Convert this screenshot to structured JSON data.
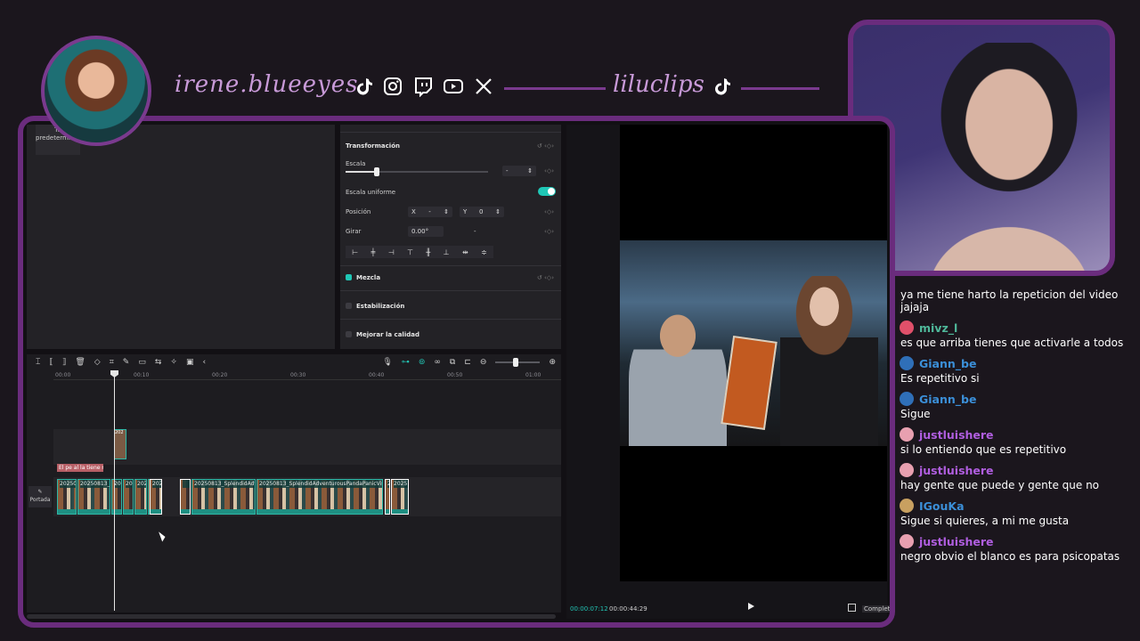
{
  "overlay": {
    "streamer_name": "irene.blueeyes",
    "clips_name": "liluclips",
    "socials": [
      "tiktok-icon",
      "instagram-icon",
      "twitch-icon",
      "youtube-icon",
      "x-icon"
    ],
    "accent_color": "#6a2c7d"
  },
  "editor": {
    "left_panel": {
      "default_tile": "Tu predeterminado"
    },
    "properties": {
      "transform_title": "Transformación",
      "scale_label": "Escala",
      "scale_value": "-",
      "uniform_scale_label": "Escala uniforme",
      "position_label": "Posición",
      "pos_x_label": "X",
      "pos_x_value": "-",
      "pos_y_label": "Y",
      "pos_y_value": "0",
      "rotate_label": "Girar",
      "rotate_value": "0.00°",
      "rotate_extra": "-",
      "blend_label": "Mezcla",
      "stabilize_label": "Estabilización",
      "enhance_label": "Mejorar la calidad"
    },
    "timeline": {
      "ruler": [
        "00:00",
        "00:10",
        "00:20",
        "00:30",
        "00:40",
        "00:50",
        "01:00"
      ],
      "cover_label": "Portada",
      "text_clip": "El pe al la tiene r",
      "overlay_clip": "202",
      "clips": [
        "20250",
        "20250813_S",
        "202",
        "20",
        "202",
        "202",
        "2025",
        "",
        "20250813_SplendidAdven",
        "20250813_SplendidAdventurousPandaPanicVis-4Z-3",
        "2",
        "2025"
      ]
    },
    "player": {
      "time_current": "00:00:07:12",
      "time_total": "00:00:44:29",
      "fit_label": "Completa"
    }
  },
  "chat": {
    "first_text": "ya me tiene harto la repeticion del video jajaja",
    "messages": [
      {
        "user": "mivz_l",
        "color": "#4fb89a",
        "badge": "#e0506a",
        "text": "es que arriba tienes que activarle a todos"
      },
      {
        "user": "Giann_be",
        "color": "#3b8fd8",
        "badge": "#2f6fb8",
        "text": "Es repetitivo si"
      },
      {
        "user": "Giann_be",
        "color": "#3b8fd8",
        "badge": "#2f6fb8",
        "text": "Sigue"
      },
      {
        "user": "justluishere",
        "color": "#b05ee0",
        "badge": "#e8a0b0",
        "text": "si lo entiendo que es repetitivo"
      },
      {
        "user": "justluishere",
        "color": "#b05ee0",
        "badge": "#e8a0b0",
        "text": "hay gente que puede y gente que no"
      },
      {
        "user": "IGouKa",
        "color": "#3b8fd8",
        "badge": "#c8a060",
        "text": "Sigue si quieres, a mi me gusta"
      },
      {
        "user": "justluishere",
        "color": "#b05ee0",
        "badge": "#e8a0b0",
        "text": "negro obvio el blanco es para psicopatas"
      }
    ]
  }
}
